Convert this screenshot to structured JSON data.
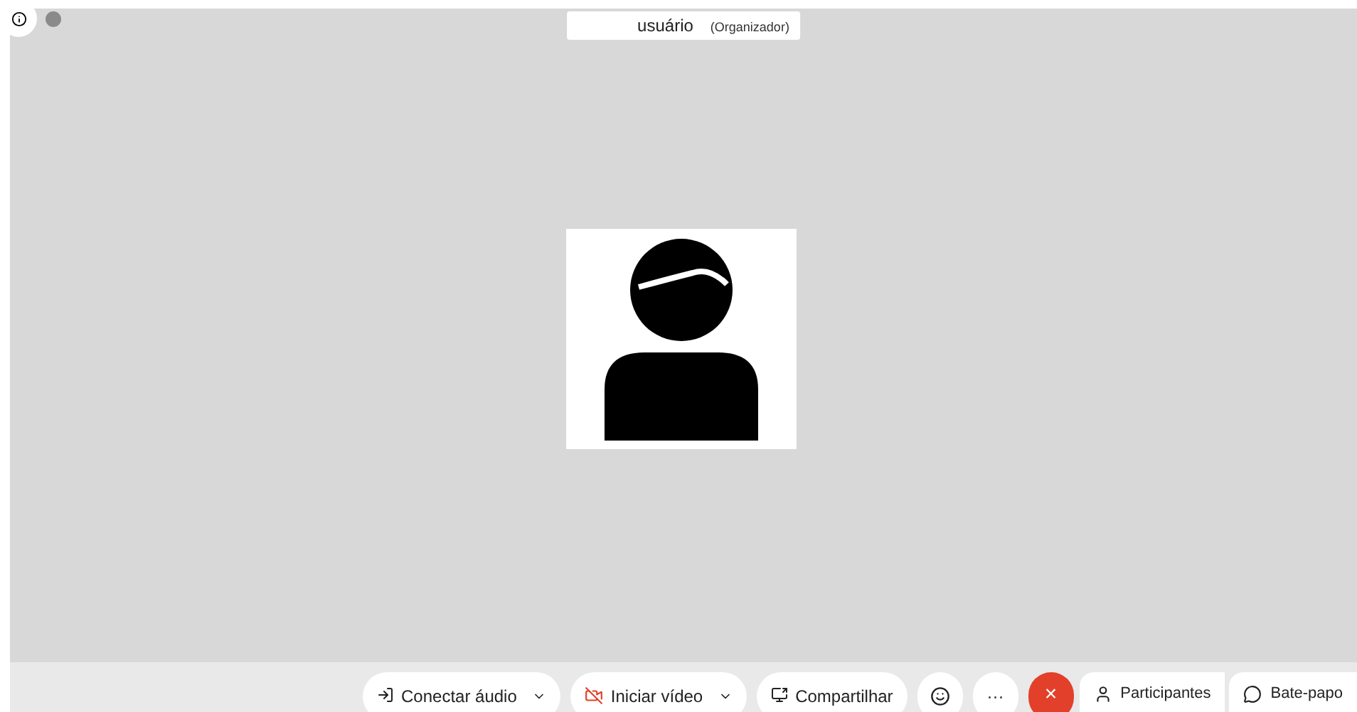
{
  "header": {
    "name": "usuário",
    "role": "(Organizador)"
  },
  "controls": [
    {
      "kind": "audio",
      "label": "Conectar áudio"
    },
    {
      "kind": "video",
      "label": "Iniciar vídeo"
    },
    {
      "kind": "share",
      "label": "Compartilhar"
    },
    {
      "kind": "reaction"
    },
    {
      "kind": "more",
      "glyph": "···"
    },
    {
      "kind": "leave",
      "glyph": "×"
    }
  ],
  "side_controls": [
    {
      "kind": "participants",
      "label": "Participantes"
    },
    {
      "kind": "chat",
      "label": "Bate-papo"
    }
  ]
}
